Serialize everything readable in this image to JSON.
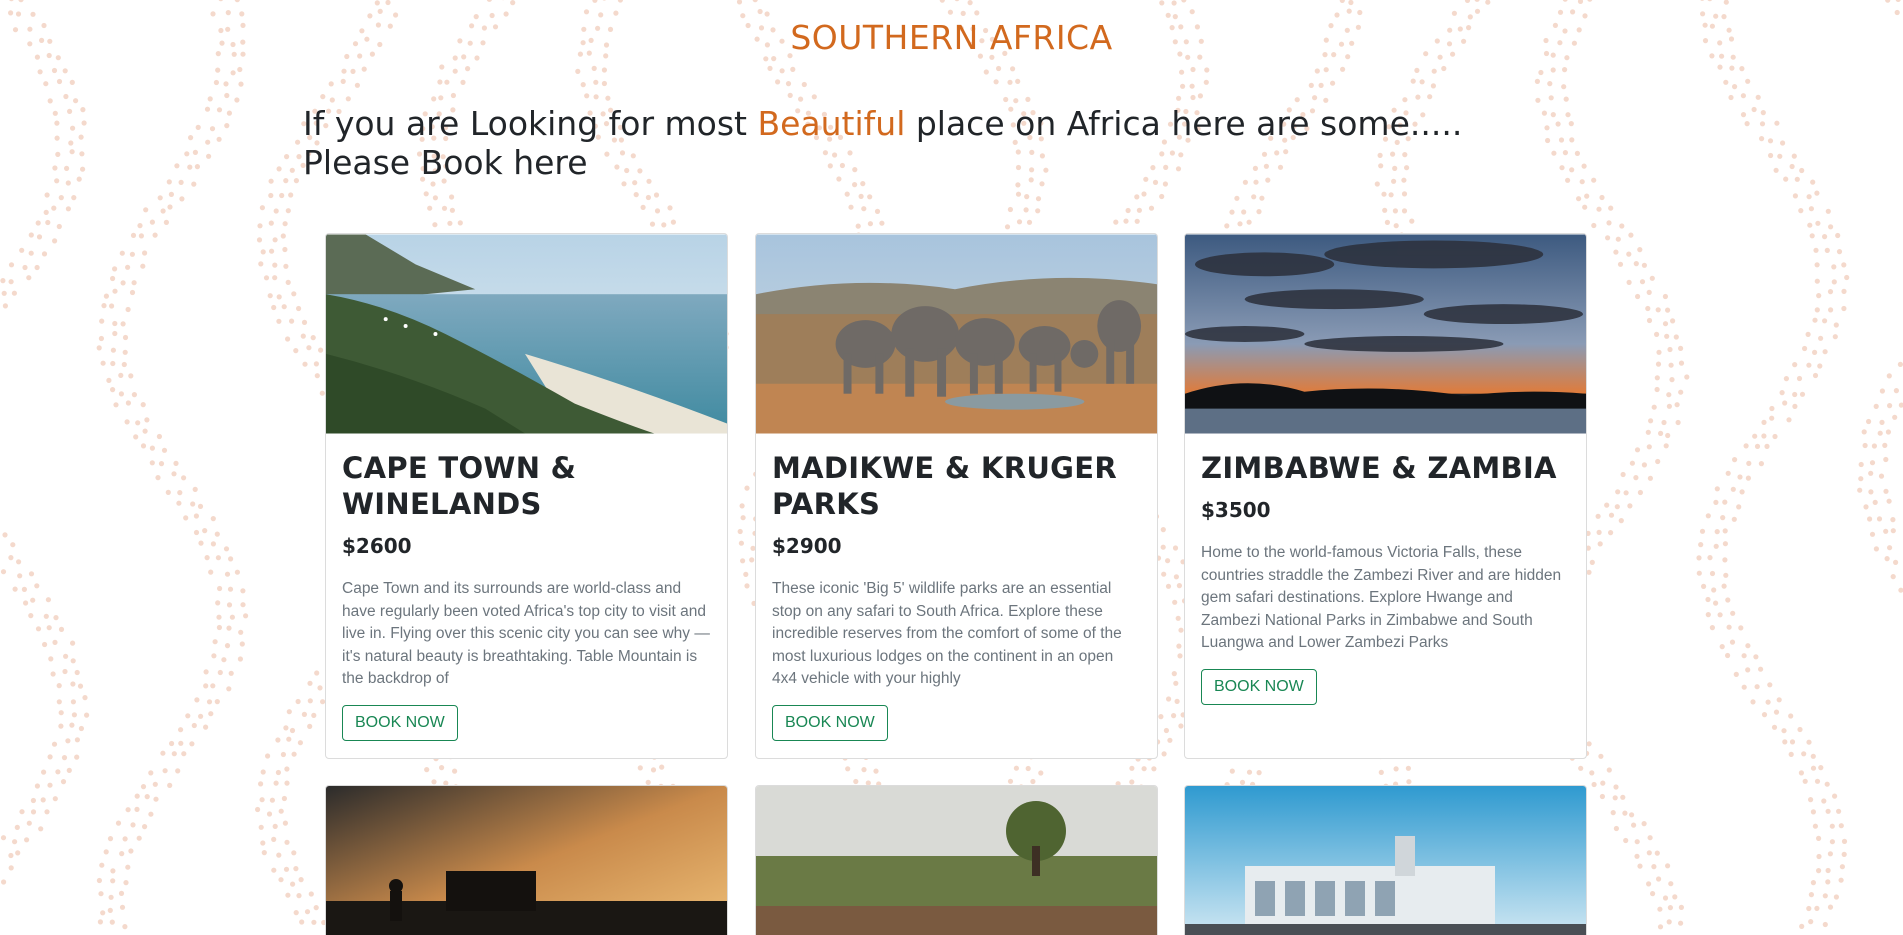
{
  "section": {
    "region_title": "SOUTHERN AFRICA",
    "accent_color": "#d2691e",
    "tagline": {
      "before": "If you are Looking for most ",
      "highlight": "Beautiful",
      "after": " place on Africa here are some..... Please Book here"
    }
  },
  "cards": [
    {
      "title": "CAPE TOWN & WINELANDS",
      "price": "$2600",
      "description": "Cape Town and its surrounds are world-class and have regularly been voted Africa's top city to visit and live in. Flying over this scenic city you can see why — it's natural beauty is breathtaking. Table Mountain is the backdrop of",
      "button": "BOOK NOW"
    },
    {
      "title": "MADIKWE & KRUGER PARKS",
      "price": "$2900",
      "description": "These iconic 'Big 5' wildlife parks are an essential stop on any safari to South Africa. Explore these incredible reserves from the comfort of some of the most luxurious lodges on the continent in an open 4x4 vehicle with your highly",
      "button": "BOOK NOW"
    },
    {
      "title": "ZIMBABWE & ZAMBIA",
      "price": "$3500",
      "description": "Home to the world-famous Victoria Falls, these countries straddle the Zambezi River and are hidden gem safari destinations. Explore Hwange and Zambezi National Parks in Zimbabwe and South Luangwa and Lower Zambezi Parks",
      "button": "BOOK NOW"
    }
  ]
}
